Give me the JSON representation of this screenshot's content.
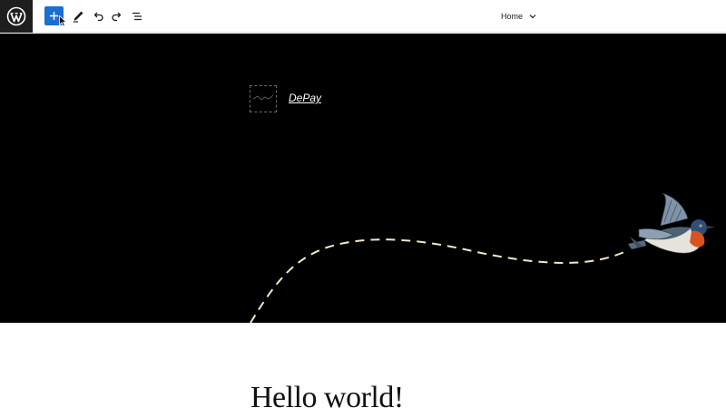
{
  "toolbar": {
    "logo_icon": "wordpress-logo-icon",
    "add_block_icon": "plus-icon",
    "tools_icon": "pencil-icon",
    "undo_icon": "undo-icon",
    "redo_icon": "redo-icon",
    "list_view_icon": "list-view-icon",
    "document_title": "Home",
    "document_dropdown_icon": "chevron-down-icon",
    "accent_color": "#1a6fd1"
  },
  "header": {
    "background_color": "#000000",
    "site_title": "DePay",
    "flight_path_color": "#f3e6c8"
  },
  "content": {
    "post_title": "Hello world!"
  }
}
